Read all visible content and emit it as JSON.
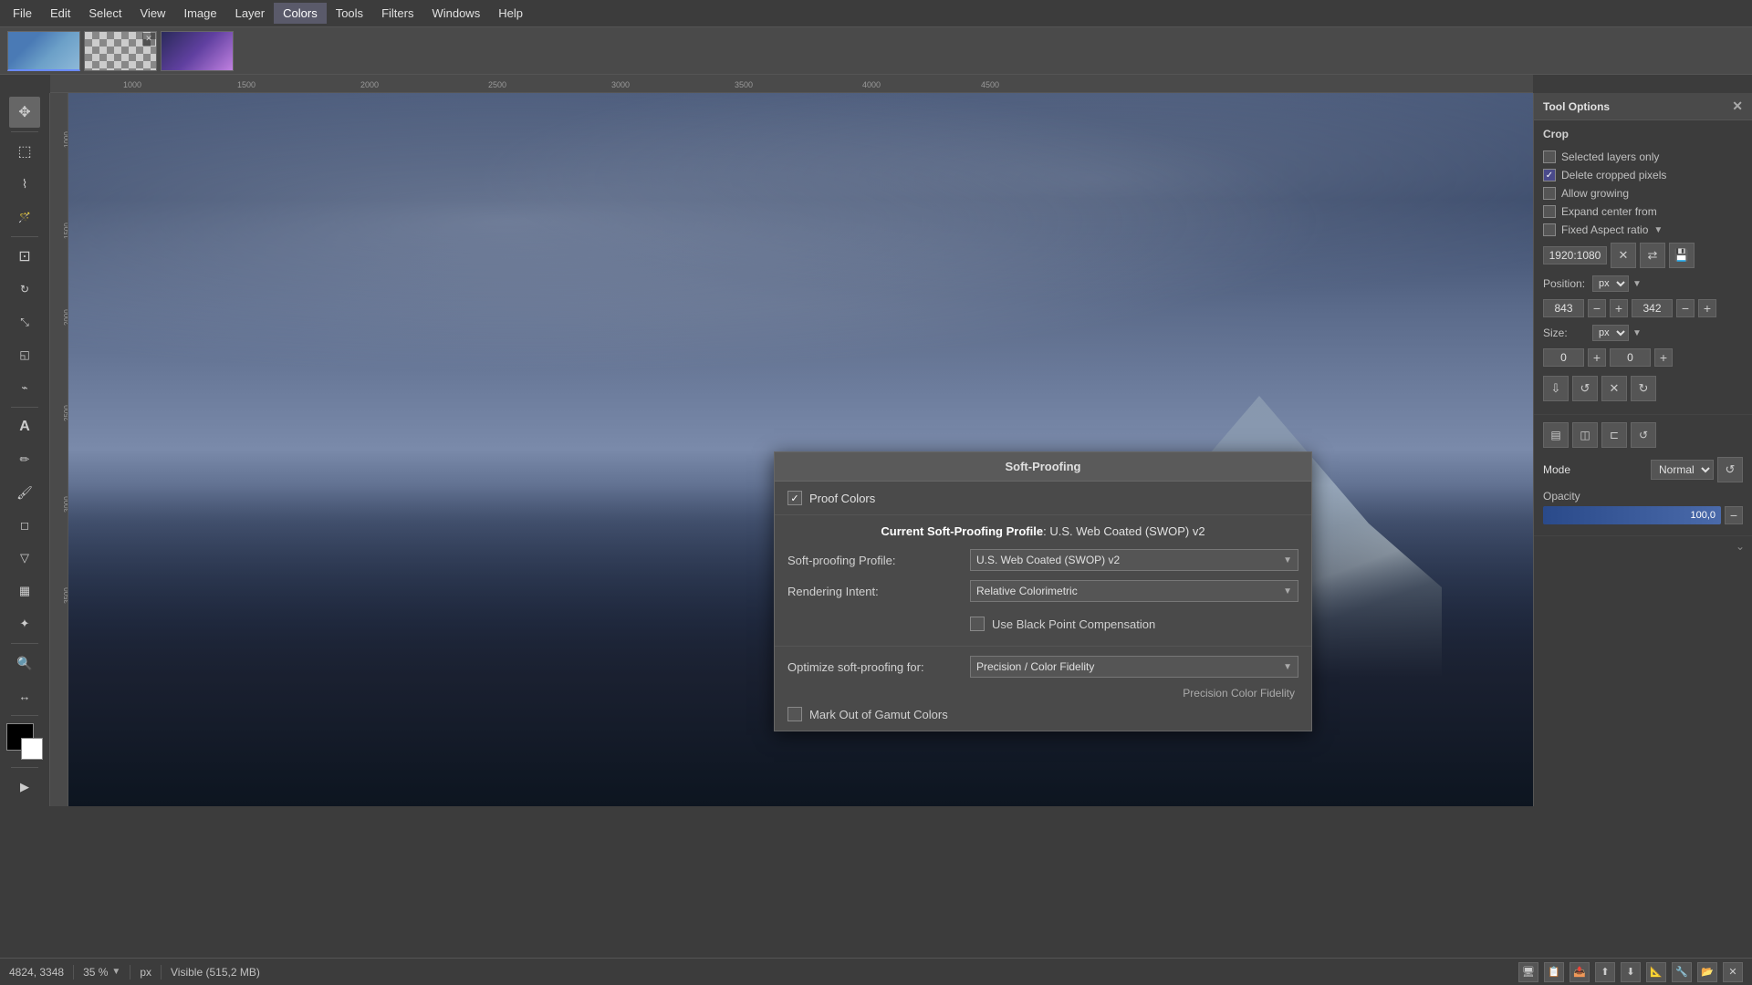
{
  "menubar": {
    "items": [
      "File",
      "Edit",
      "Select",
      "View",
      "Image",
      "Layer",
      "Colors",
      "Tools",
      "Filters",
      "Windows",
      "Help"
    ]
  },
  "tabs": [
    {
      "id": 1,
      "type": "landscape",
      "active": true
    },
    {
      "id": 2,
      "type": "checker",
      "active": false
    },
    {
      "id": 3,
      "type": "purple",
      "active": false
    }
  ],
  "ruler": {
    "h_ticks": [
      "1000",
      "1500",
      "2000",
      "2500",
      "3000",
      "3500",
      "4000",
      "4500"
    ],
    "v_ticks": [
      "1000",
      "1500",
      "2000",
      "2500",
      "3000",
      "3500"
    ]
  },
  "tool_options": {
    "title": "Tool Options",
    "crop": {
      "title": "Crop",
      "selected_layers_only": "Selected layers only",
      "delete_cropped_pixels": "Delete cropped pixels",
      "allow_growing": "Allow growing",
      "expand_from_center": "Expand center from",
      "fixed_aspect_ratio": "Fixed Aspect ratio",
      "dimension": "1920:1080",
      "position_label": "Position:",
      "px_unit": "px",
      "pos_x": "843",
      "pos_y": "342",
      "size_label": "Size:",
      "size_x": "0",
      "size_y": "0"
    }
  },
  "mode": {
    "label": "Mode",
    "value": "Normal"
  },
  "opacity": {
    "label": "Opacity",
    "value": "100,0"
  },
  "soft_proofing": {
    "title": "Soft-Proofing",
    "proof_colors": "Proof Colors",
    "current_profile_label": "Current Soft-Proofing Profile",
    "current_profile_value": "U.S. Web Coated (SWOP) v2",
    "profile_label": "Soft-proofing Profile:",
    "profile_value": "U.S. Web Coated (SWOP) v2",
    "rendering_label": "Rendering Intent:",
    "rendering_value": "Relative Colorimetric",
    "black_point": "Use Black Point Compensation",
    "optimize_label": "Optimize soft-proofing for:",
    "optimize_value": "Precision / Color Fidelity",
    "gamut_label": "Mark Out of Gamut Colors",
    "precision_label": "Precision Color Fidelity"
  },
  "statusbar": {
    "coordinates": "4824, 3348",
    "unit": "px",
    "zoom": "35 %",
    "visibility": "Visible (515,2 MB)"
  },
  "colors_menu": {
    "label": "Colors"
  }
}
